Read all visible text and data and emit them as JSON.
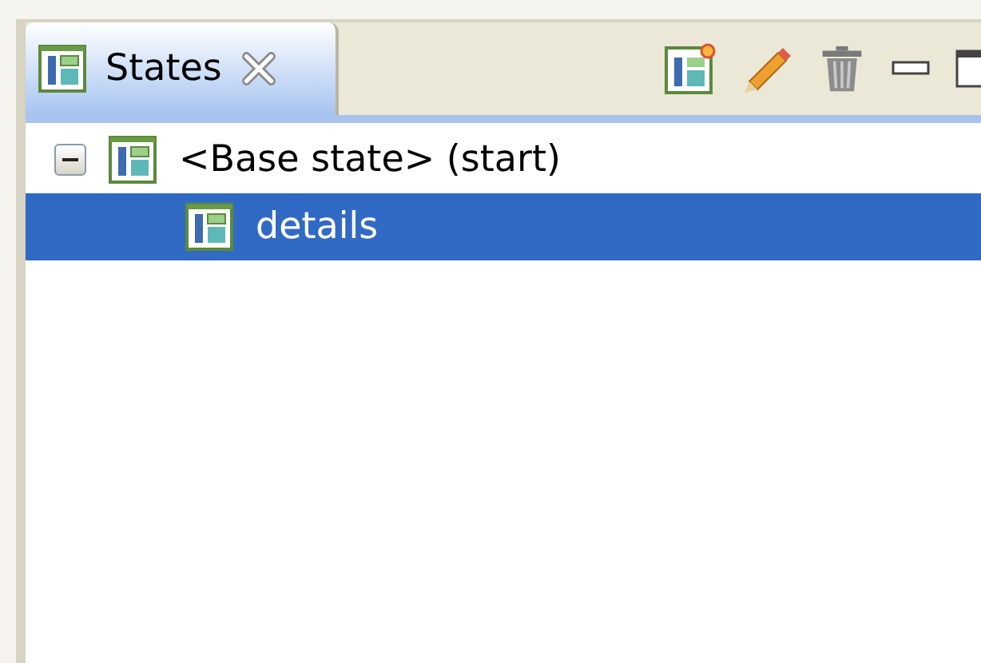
{
  "tab": {
    "label": "States",
    "selected": true
  },
  "tree": [
    {
      "label": "<Base state> (start)",
      "selected": false,
      "expanded": true,
      "children": [
        {
          "label": "details",
          "selected": true
        }
      ]
    }
  ]
}
